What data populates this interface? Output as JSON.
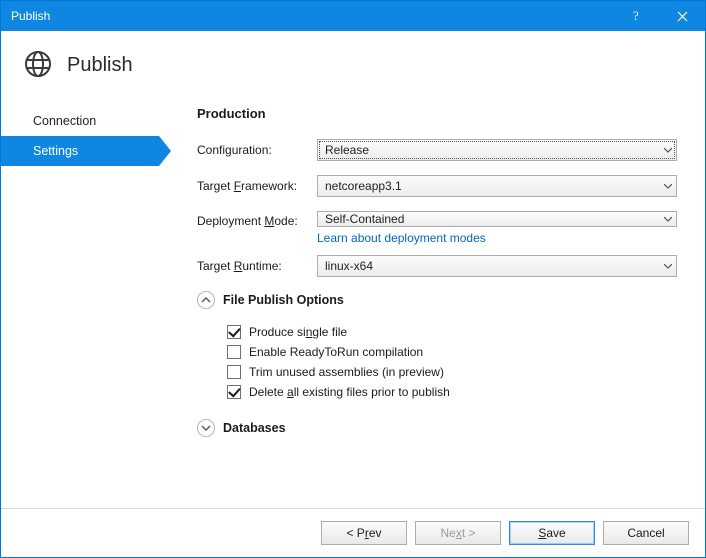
{
  "window": {
    "title": "Publish"
  },
  "header": {
    "caption": "Publish"
  },
  "sidebar": {
    "items": [
      {
        "label": "Connection",
        "active": false
      },
      {
        "label": "Settings",
        "active": true
      }
    ]
  },
  "content": {
    "profile_title": "Production",
    "rows": {
      "configuration": {
        "label_pre": "Confi",
        "accel": "g",
        "label_post": "uration:",
        "value": "Release",
        "focused": true
      },
      "target_framework": {
        "label_pre": "Target ",
        "accel": "F",
        "label_post": "ramework:",
        "value": "netcoreapp3.1"
      },
      "deployment_mode": {
        "label_pre": "Deployment ",
        "accel": "M",
        "label_post": "ode:",
        "value": "Self-Contained",
        "link": "Learn about deployment modes"
      },
      "target_runtime": {
        "label_pre": "Target ",
        "accel": "R",
        "label_post": "untime:",
        "value": "linux-x64"
      }
    },
    "expanders": {
      "file_publish": {
        "title": "File Publish Options",
        "expanded": true,
        "options": [
          {
            "label_pre": "Produce si",
            "accel": "n",
            "label_post": "gle file",
            "checked": true
          },
          {
            "label_pre": "Enable ReadyToRun compilation",
            "accel": "",
            "label_post": "",
            "checked": false
          },
          {
            "label_pre": "Trim unused assemblies (in preview)",
            "accel": "",
            "label_post": "",
            "checked": false
          },
          {
            "label_pre": "Delete ",
            "accel": "a",
            "label_post": "ll existing files prior to publish",
            "checked": true
          }
        ]
      },
      "databases": {
        "title": "Databases",
        "expanded": false
      }
    }
  },
  "footer": {
    "prev": {
      "pre": "< P",
      "accel": "r",
      "post": "ev"
    },
    "next": {
      "pre": "Ne",
      "accel": "x",
      "post": "t >"
    },
    "save": {
      "pre": "",
      "accel": "S",
      "post": "ave"
    },
    "cancel": {
      "label": "Cancel"
    }
  }
}
